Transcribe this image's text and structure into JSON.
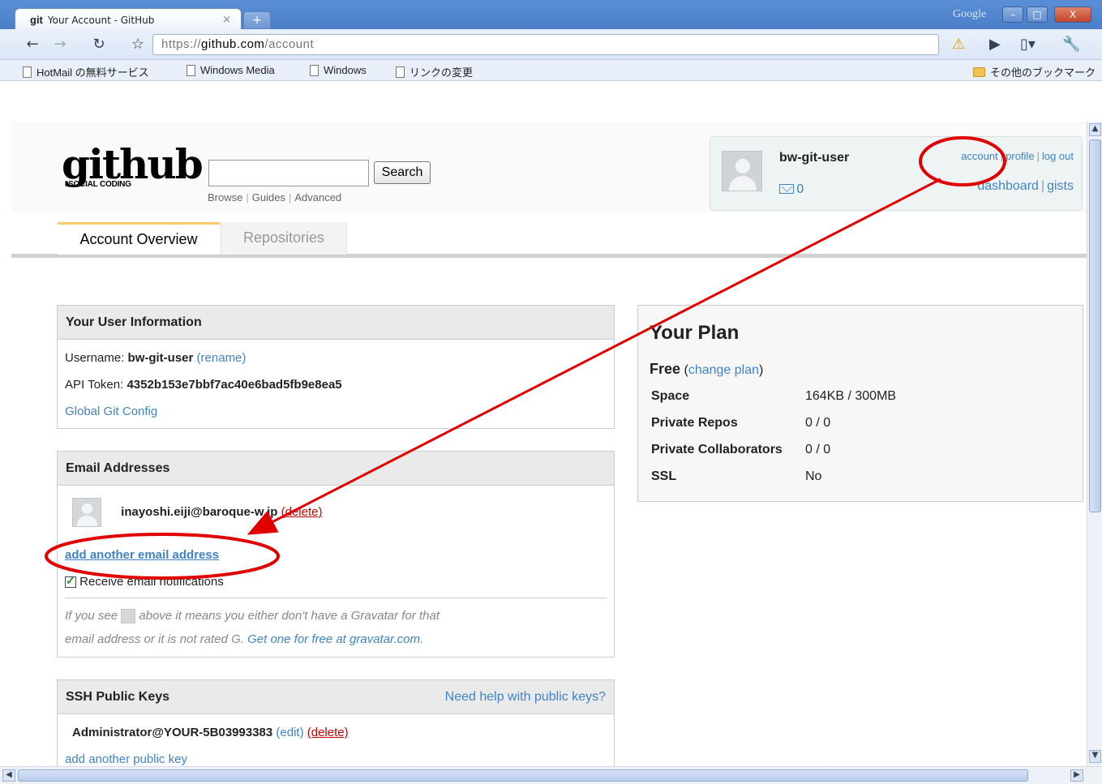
{
  "browser": {
    "tab_title": "Your Account - GitHub",
    "tab_favicon": "git",
    "tab_close": "×",
    "new_tab": "+",
    "google_label": "Google",
    "url_scheme": "https://",
    "url_host": "github.com",
    "url_path": "/account",
    "bookmarks": [
      "HotMail の無料サービス",
      "Windows Media",
      "Windows",
      "リンクの変更"
    ],
    "other_bookmarks": "その他のブックマーク"
  },
  "header": {
    "logo_word": "github",
    "logo_tag": "SOCIAL CODING",
    "search_button": "Search",
    "search_value": "",
    "browse": "Browse",
    "guides": "Guides",
    "advanced": "Advanced",
    "username": "bw-git-user",
    "inbox_count": "0",
    "account": "account",
    "profile": "profile",
    "log_out": "log out",
    "dashboard": "dashboard",
    "gists": "gists"
  },
  "tabs": {
    "active": "Account Overview",
    "repositories": "Repositories"
  },
  "user_info": {
    "title": "Your User Information",
    "username_label": "Username:",
    "username_value": "bw-git-user",
    "rename": "(rename)",
    "api_label": "API Token:",
    "api_value": "4352b153e7bbf7ac40e6bad5fb9e8ea5",
    "global_config": "Global Git Config"
  },
  "emails": {
    "title": "Email Addresses",
    "address": "inayoshi.eiji@baroque-w.jp",
    "delete": "(delete)",
    "add_another": "add another email address",
    "receive_label": "Receive email notifications",
    "receive_checked": true,
    "note_prefix": "If you see",
    "note_mid": "above it means you either don't have a Gravatar for that",
    "note_line2": "email address or it is not rated G.",
    "note_link": "Get one for free at gravatar.com."
  },
  "ssh": {
    "title": "SSH Public Keys",
    "help": "Need help with public keys?",
    "key_name": "Administrator@YOUR-5B03993383",
    "edit": "(edit)",
    "delete": "(delete)",
    "add_key": "add another public key"
  },
  "plan": {
    "title": "Your Plan",
    "plan_name": "Free",
    "change_plan": "change plan",
    "rows": [
      {
        "label": "Space",
        "value": "164KB / 300MB"
      },
      {
        "label": "Private Repos",
        "value": "0 / 0"
      },
      {
        "label": "Private Collaborators",
        "value": "0 / 0"
      },
      {
        "label": "SSL",
        "value": "No"
      }
    ]
  },
  "colors": {
    "link": "#4183c4",
    "annotation": "#e00000",
    "tab_accent": "#ffc96b"
  }
}
